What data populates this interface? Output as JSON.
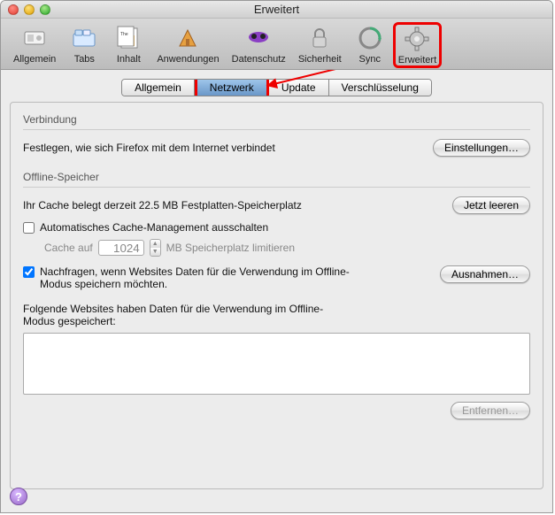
{
  "window": {
    "title": "Erweitert"
  },
  "toolbar": {
    "items": [
      {
        "label": "Allgemein",
        "icon": "switch-icon"
      },
      {
        "label": "Tabs",
        "icon": "tabs-icon"
      },
      {
        "label": "Inhalt",
        "icon": "content-icon"
      },
      {
        "label": "Anwendungen",
        "icon": "applications-icon"
      },
      {
        "label": "Datenschutz",
        "icon": "privacy-icon"
      },
      {
        "label": "Sicherheit",
        "icon": "security-icon"
      },
      {
        "label": "Sync",
        "icon": "sync-icon"
      },
      {
        "label": "Erweitert",
        "icon": "advanced-icon"
      }
    ]
  },
  "tabs": {
    "items": [
      "Allgemein",
      "Netzwerk",
      "Update",
      "Verschlüsselung"
    ],
    "active": "Netzwerk"
  },
  "sections": {
    "connection": {
      "heading": "Verbindung",
      "desc": "Festlegen, wie sich Firefox mit dem Internet verbindet",
      "button": "Einstellungen…"
    },
    "offline": {
      "heading": "Offline-Speicher",
      "cache_line": "Ihr Cache belegt derzeit 22.5 MB Festplatten-Speicherplatz",
      "clear_button": "Jetzt leeren",
      "override_label": "Automatisches Cache-Management ausschalten",
      "limit_prefix": "Cache auf",
      "limit_value": "1024",
      "limit_suffix": "MB Speicherplatz limitieren",
      "ask_label": "Nachfragen, wenn Websites Daten für die Verwendung im Offline-Modus speichern möchten.",
      "exceptions_button": "Ausnahmen…",
      "stored_label": "Folgende Websites haben Daten für die Verwendung im Offline-Modus gespeichert:",
      "remove_button": "Entfernen…"
    }
  },
  "help_glyph": "?"
}
